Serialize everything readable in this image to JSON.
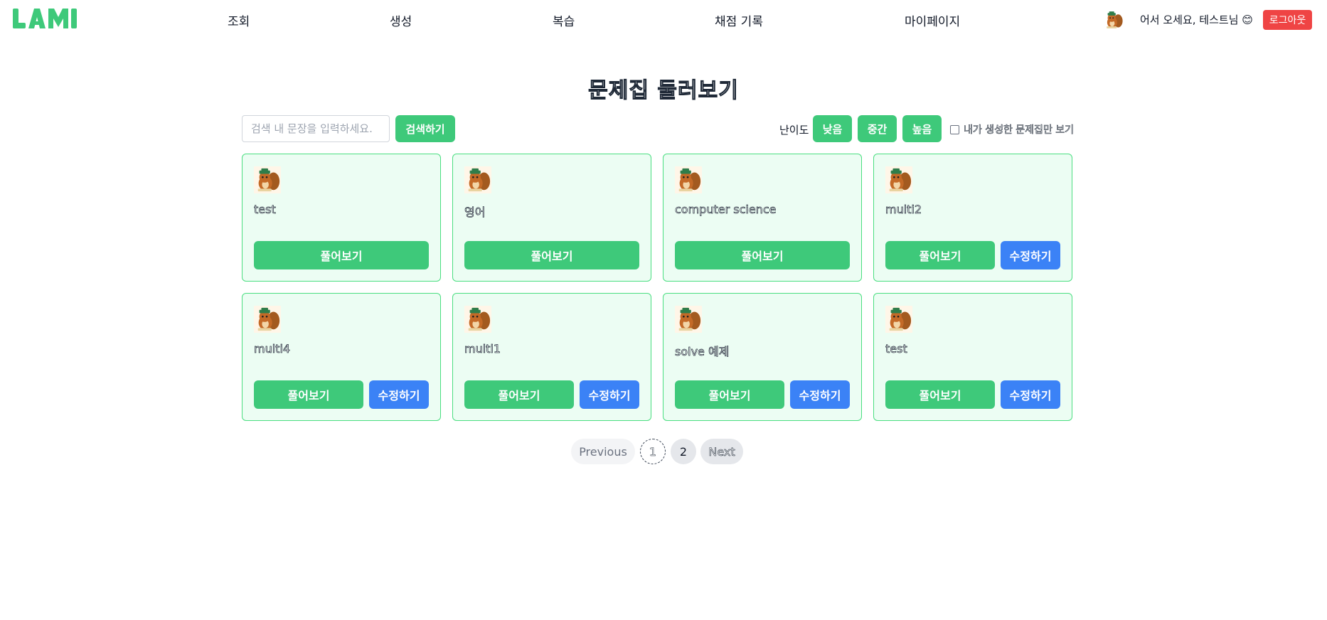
{
  "header": {
    "logo_text": "LAMI",
    "nav": [
      "조회",
      "생성",
      "복습",
      "채점 기록",
      "마이페이지"
    ],
    "welcome": "어서 오세요, 테스트님 😊",
    "logout": "로그아웃"
  },
  "page_title": "문제집 둘러보기",
  "toolbar": {
    "search_placeholder": "검색 내 문장을 입력하세요.",
    "search_value": "",
    "search_button": "검색하기",
    "difficulty_label": "난이도",
    "difficulty_options": [
      "낮음",
      "중간",
      "높음"
    ],
    "mine_only_label": "내가 생성한 문제집만 보기",
    "mine_only_checked": false
  },
  "cards": [
    {
      "title": "test",
      "solve_label": "풀어보기",
      "edit_label": ""
    },
    {
      "title": "영어",
      "solve_label": "풀어보기",
      "edit_label": ""
    },
    {
      "title": "computer science",
      "solve_label": "풀어보기",
      "edit_label": ""
    },
    {
      "title": "multi2",
      "solve_label": "풀어보기",
      "edit_label": "수정하기"
    },
    {
      "title": "multi4",
      "solve_label": "풀어보기",
      "edit_label": "수정하기"
    },
    {
      "title": "multi1",
      "solve_label": "풀어보기",
      "edit_label": "수정하기"
    },
    {
      "title": "solve 예제",
      "solve_label": "풀어보기",
      "edit_label": "수정하기"
    },
    {
      "title": "test",
      "solve_label": "풀어보기",
      "edit_label": "수정하기"
    }
  ],
  "pagination": {
    "previous": "Previous",
    "pages": [
      "1",
      "2"
    ],
    "current_page": "1",
    "next": "Next"
  },
  "colors": {
    "brand_green": "#3ec97a",
    "edit_blue": "#3b82f6",
    "logout_red": "#ef4444",
    "card_bg": "#ecfdf3",
    "card_border": "#4ade80"
  },
  "icons": {
    "avatar": "squirrel-avatar-icon",
    "logo": "lami-logo"
  }
}
